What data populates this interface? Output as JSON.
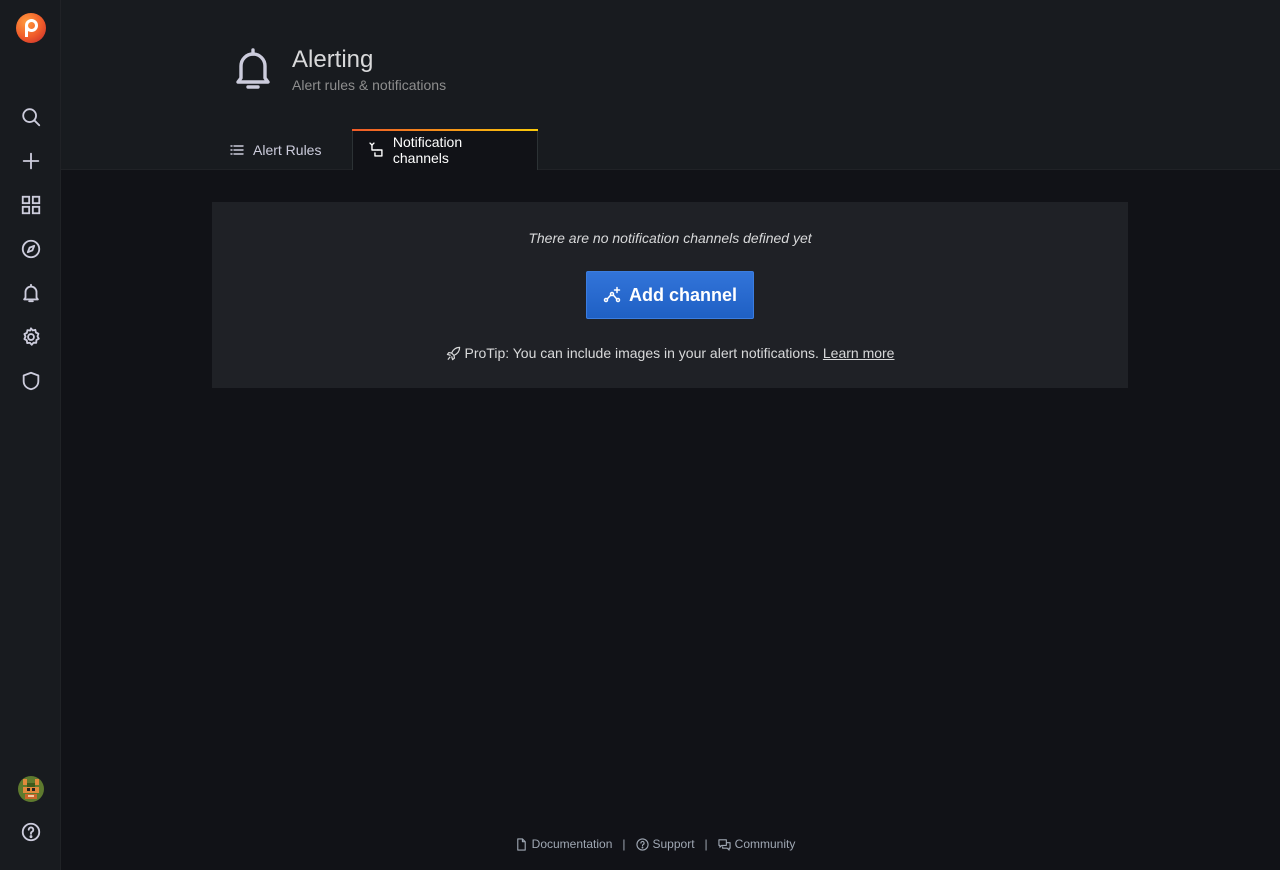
{
  "sidebar": {
    "items": [
      {
        "name": "search",
        "icon": "search-icon"
      },
      {
        "name": "create",
        "icon": "plus-icon"
      },
      {
        "name": "dashboards",
        "icon": "apps-icon"
      },
      {
        "name": "explore",
        "icon": "compass-icon"
      },
      {
        "name": "alerting",
        "icon": "bell-icon"
      },
      {
        "name": "configuration",
        "icon": "cog-icon"
      },
      {
        "name": "server-admin",
        "icon": "shield-icon"
      }
    ],
    "help_icon": "question-circle-icon"
  },
  "header": {
    "title": "Alerting",
    "subtitle": "Alert rules & notifications",
    "icon": "bell-icon"
  },
  "tabs": [
    {
      "label": "Alert Rules",
      "icon": "list-icon",
      "active": false
    },
    {
      "label": "Notification channels",
      "icon": "channel-icon",
      "active": true
    }
  ],
  "empty_state": {
    "message": "There are no notification channels defined yet",
    "button_label": "Add channel",
    "protip": "ProTip: You can include images in your alert notifications.",
    "learn_more": "Learn more"
  },
  "footer": {
    "documentation": "Documentation",
    "support": "Support",
    "community": "Community",
    "separator": "|"
  },
  "colors": {
    "accent_blue": "#3274d9",
    "tab_gradient_start": "#f05a28",
    "tab_gradient_end": "#fbca0a",
    "background": "#111217",
    "panel": "#181b1f"
  }
}
